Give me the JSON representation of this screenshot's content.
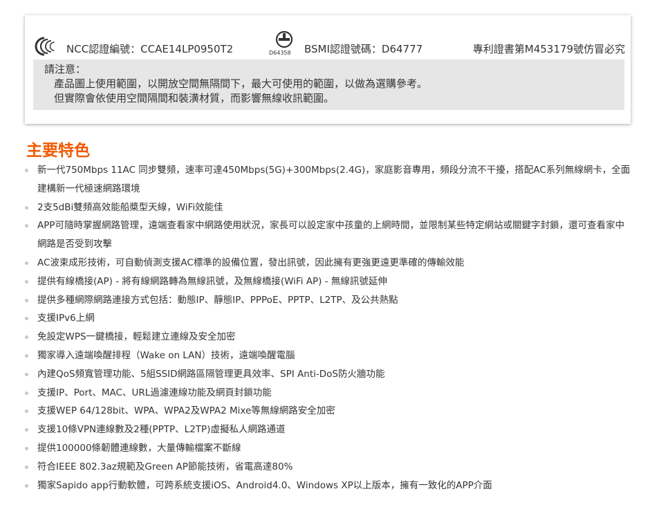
{
  "certification": {
    "ncc_label": "NCC認證編號：CCAE14LP0950T2",
    "ncc_icon": "ncc-logo-icon",
    "bsmi_icon": "bsmi-logo-icon",
    "bsmi_code": "D64358",
    "bsmi_label": "BSMI認證號碼：D64777",
    "patent_label": "專利證書第M453179號仿冒必究"
  },
  "notice": {
    "title": "請注意：",
    "lines": [
      "產品圖上使用範圍，以開放空間無隔間下，最大可使用的範圍，以做為選購參考。",
      "但實際會依使用空間隔間和裝潢材質，而影響無線收訊範圍。"
    ]
  },
  "features": {
    "title": "主要特色",
    "items": [
      "新一代750Mbps 11AC 同步雙頻，速率可達450Mbps(5G)+300Mbps(2.4G)，家庭影音專用，頻段分流不干擾，搭配AC系列無線網卡，全面建構新一代極速網路環境",
      "2支5dBi雙頻高效能船槳型天線，WiFi效能佳",
      "APP可隨時掌握網路管理，遠端查看家中網路使用狀況，家長可以設定家中孩童的上網時間，並限制某些特定網站或關鍵字封鎖，還可查看家中網路是否受到攻擊",
      "AC波束成形技術，可自動偵測支援AC標準的設備位置，發出訊號，因此擁有更強更遠更準確的傳輸效能",
      "提供有線橋接(AP) - 將有線網路轉為無線訊號，及無線橋接(WiFi AP) - 無線訊號延伸",
      "提供多種網際網路連接方式包括：動態IP、靜態IP、PPPoE、PPTP、L2TP、及公共熱點",
      "支援IPv6上網",
      "免設定WPS一鍵橋接，輕鬆建立連線及安全加密",
      "獨家導入遠端喚醒排程（Wake on LAN）技術，遠端喚醒電腦",
      "內建QoS頻寬管理功能、5組SSID網路區隔管理更具效率、SPI Anti-DoS防火牆功能",
      "支援IP、Port、MAC、URL過濾連線功能及網頁封鎖功能",
      "支援WEP 64/128bit、WPA、WPA2及WPA2 Mixe等無線網路安全加密",
      "支援10條VPN連線數及2種(PPTP、L2TP)虛擬私人網路通道",
      "提供100000條韌體連線數，大量傳輸檔案不斷線",
      "符合IEEE 802.3az規範及Green AP節能技術，省電高達80%",
      "獨家Sapido app行動軟體，可跨系統支援iOS、Android4.0、Windows XP以上版本，擁有一致化的APP介面"
    ]
  },
  "colors": {
    "accent": "#f05a00",
    "notice_bg": "#e6e6e6",
    "bullet": "#c8c8c8"
  }
}
